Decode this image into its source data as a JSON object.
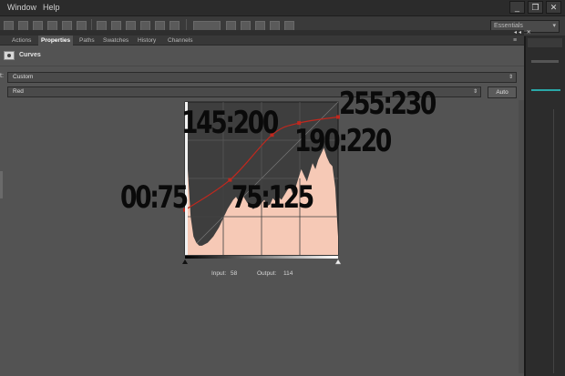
{
  "menubar": {
    "items": [
      "Window",
      "Help"
    ],
    "window_buttons": [
      "_",
      "❐",
      "✕"
    ]
  },
  "optionsbar": {
    "workspace_value": "Essentials"
  },
  "panel": {
    "tabs": [
      "Actions",
      "Properties",
      "Paths",
      "Swatches",
      "History",
      "Channels"
    ],
    "active_tab": "Properties",
    "title": "Curves",
    "preset_label": "t:",
    "preset_value": "Custom",
    "channel_value": "Red",
    "auto_label": "Auto"
  },
  "readout": {
    "input_label": "Input:",
    "input_value": "58",
    "output_label": "Output:",
    "output_value": "114"
  },
  "curve": {
    "color": "#c0281e",
    "histogram_color": "#f6c9b6",
    "points": [
      {
        "input": 0,
        "output": 75,
        "label": "00:75"
      },
      {
        "input": 75,
        "output": 125,
        "label": "75:125"
      },
      {
        "input": 145,
        "output": 200,
        "label": "145:200"
      },
      {
        "input": 190,
        "output": 220,
        "label": "190:220"
      },
      {
        "input": 255,
        "output": 230,
        "label": "255:230"
      }
    ]
  }
}
